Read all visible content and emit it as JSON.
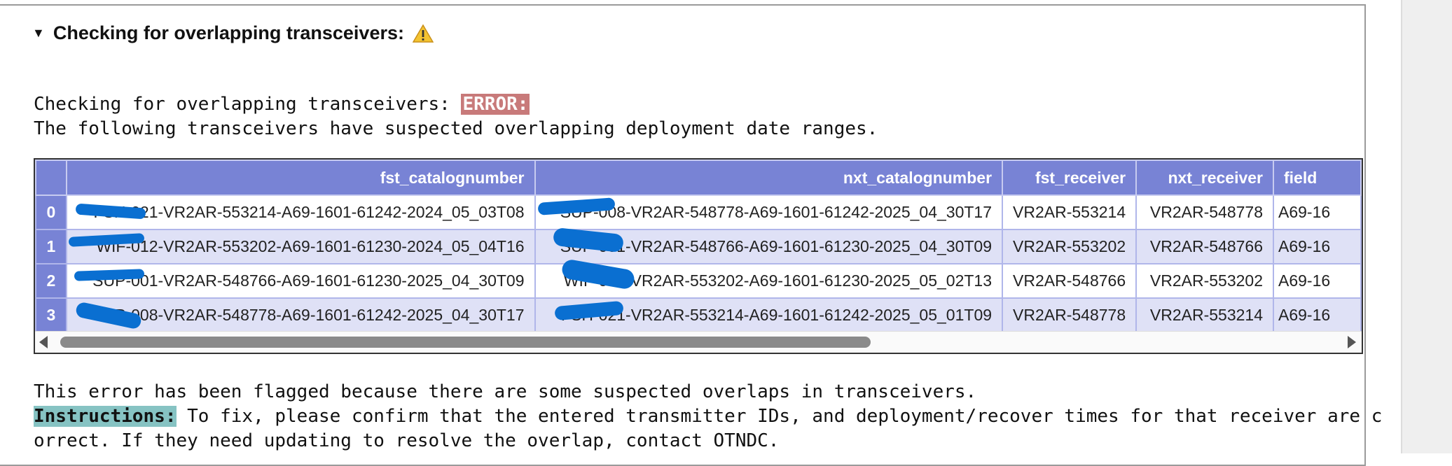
{
  "section": {
    "title": "Checking for overlapping transceivers:",
    "warning_icon": "warning-icon"
  },
  "message": {
    "line1_prefix": "Checking for overlapping transceivers: ",
    "error_label": "ERROR:",
    "line2": "The following transceivers have suspected overlapping deployment date ranges."
  },
  "table": {
    "columns": [
      "",
      "fst_catalognumber",
      "nxt_catalognumber",
      "fst_receiver",
      "nxt_receiver",
      "field"
    ],
    "rows": [
      {
        "idx": "0",
        "fst_catalognumber": "FSH-021-VR2AR-553214-A69-1601-61242-2024_05_03T08",
        "nxt_catalognumber": "SUP-008-VR2AR-548778-A69-1601-61242-2025_04_30T17",
        "fst_receiver": "VR2AR-553214",
        "nxt_receiver": "VR2AR-548778",
        "field": "A69-16"
      },
      {
        "idx": "1",
        "fst_catalognumber": "WIF-012-VR2AR-553202-A69-1601-61230-2024_05_04T16",
        "nxt_catalognumber": "SUP-001-VR2AR-548766-A69-1601-61230-2025_04_30T09",
        "fst_receiver": "VR2AR-553202",
        "nxt_receiver": "VR2AR-548766",
        "field": "A69-16"
      },
      {
        "idx": "2",
        "fst_catalognumber": "SUP-001-VR2AR-548766-A69-1601-61230-2025_04_30T09",
        "nxt_catalognumber": "WIF-012-VR2AR-553202-A69-1601-61230-2025_05_02T13",
        "fst_receiver": "VR2AR-548766",
        "nxt_receiver": "VR2AR-553202",
        "field": "A69-16"
      },
      {
        "idx": "3",
        "fst_catalognumber": "SUP-008-VR2AR-548778-A69-1601-61242-2025_04_30T17",
        "nxt_catalognumber": "FSH-021-VR2AR-553214-A69-1601-61242-2025_05_01T09",
        "fst_receiver": "VR2AR-548778",
        "nxt_receiver": "VR2AR-553214",
        "field": "A69-16"
      }
    ]
  },
  "footer": {
    "line1": "This error has been flagged because there are some suspected overlaps in transceivers.",
    "instructions_label": "Instructions:",
    "line2_rest": " To fix, please confirm that the entered transmitter IDs, and deployment/recover times for that receiver are c",
    "line3": "orrect. If they need updating to resolve the overlap, contact OTNDC."
  },
  "colors": {
    "header_bg": "#7883d5",
    "error_bg": "#c87a7a",
    "instructions_bg": "#86c3c3",
    "redaction": "#0a6fd1"
  }
}
